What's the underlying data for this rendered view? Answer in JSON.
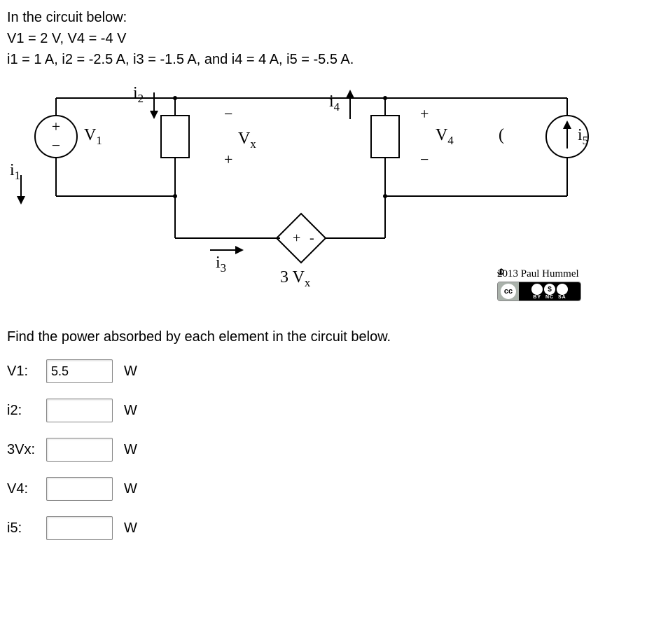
{
  "problem": {
    "line1": "In the circuit below:",
    "line2": "V1 = 2 V,   V4 = -4 V",
    "line3": "i1 = 1 A,   i2 = -2.5 A,   i3 = -1.5 A,   and   i4 = 4 A,   i5 = -5.5 A."
  },
  "circuit": {
    "V1": "V",
    "V1_sub": "1",
    "i1": "i",
    "i1_sub": "1",
    "i2": "i",
    "i2_sub": "2",
    "Vx": "V",
    "Vx_sub": "x",
    "i3": "i",
    "i3_sub": "3",
    "i4": "i",
    "i4_sub": "4",
    "V4": "V",
    "V4_sub": "4",
    "i5": "i",
    "i5_sub": "5",
    "dep_src": "3 V",
    "dep_src_sub": "x",
    "plus": "+",
    "minus": "−"
  },
  "attribution": {
    "text": "2013 Paul Hummel",
    "cc": "cc",
    "by": "BY",
    "nc": "NC",
    "sa": "SA"
  },
  "question": "Find the power absorbed by each element in the circuit below.",
  "answers": [
    {
      "label": "V1:",
      "value": "5.5",
      "unit": "W"
    },
    {
      "label": "i2:",
      "value": "",
      "unit": "W"
    },
    {
      "label": "3Vx:",
      "value": "",
      "unit": "W"
    },
    {
      "label": "V4:",
      "value": "",
      "unit": "W"
    },
    {
      "label": "i5:",
      "value": "",
      "unit": "W"
    }
  ]
}
